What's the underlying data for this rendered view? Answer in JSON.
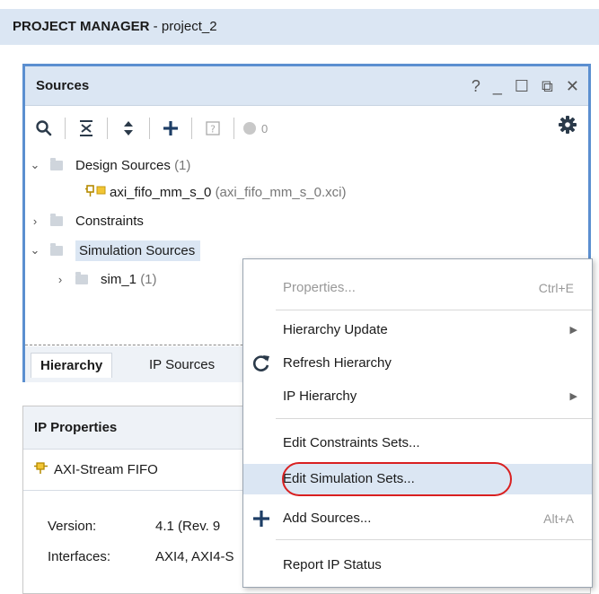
{
  "header": {
    "title_bold": "PROJECT MANAGER",
    "title_rest": " - project_2"
  },
  "sources": {
    "title": "Sources",
    "controls": {
      "help": "?",
      "minimize": "_",
      "maximize": "☐",
      "float": "⧉",
      "close": "✕"
    },
    "toolbar": {
      "count": "0"
    },
    "tree": {
      "design_sources": {
        "label": "Design Sources",
        "count": "(1)"
      },
      "ip_core": {
        "label": "axi_fifo_mm_s_0",
        "file": "(axi_fifo_mm_s_0.xci)"
      },
      "constraints": {
        "label": "Constraints"
      },
      "simulation_sources": {
        "label": "Simulation Sources"
      },
      "sim_1": {
        "label": "sim_1",
        "count": "(1)"
      }
    },
    "tabs": {
      "hierarchy": "Hierarchy",
      "ip_sources": "IP Sources"
    }
  },
  "ip_properties": {
    "title": "IP Properties",
    "name": "AXI-Stream FIFO",
    "version_label": "Version:",
    "version_value": "4.1 (Rev. 9",
    "interfaces_label": "Interfaces:",
    "interfaces_value": "AXI4, AXI4-S"
  },
  "context_menu": {
    "properties": {
      "label": "Properties...",
      "shortcut": "Ctrl+E"
    },
    "hierarchy_update": {
      "label": "Hierarchy Update"
    },
    "refresh_hierarchy": {
      "label": "Refresh Hierarchy"
    },
    "ip_hierarchy": {
      "label": "IP Hierarchy"
    },
    "edit_constraints_sets": {
      "label": "Edit Constraints Sets..."
    },
    "edit_simulation_sets": {
      "label": "Edit Simulation Sets..."
    },
    "add_sources": {
      "label": "Add Sources...",
      "shortcut": "Alt+A"
    },
    "report_ip_status": {
      "label": "Report IP Status"
    }
  },
  "colors": {
    "accent": "#5b8fd0",
    "header_bg": "#dbe6f3",
    "highlight": "#d92020"
  }
}
